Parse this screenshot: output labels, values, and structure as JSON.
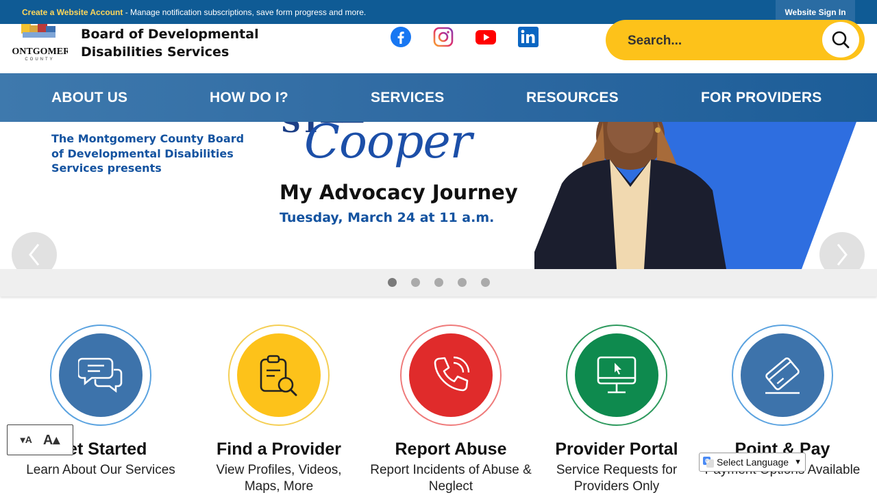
{
  "topbar": {
    "promo_link": "Create a Website Account",
    "promo_text": " - Manage notification subscriptions, save form progress and more.",
    "signin": "Website Sign In"
  },
  "header": {
    "logo_text_line1": "Board of Developmental",
    "logo_text_line2": "Disabilities Services",
    "logo_lettering": "MONTGOMERY COUNTY",
    "social": [
      "facebook-icon",
      "instagram-icon",
      "youtube-icon",
      "linkedin-icon"
    ]
  },
  "search": {
    "placeholder": "Search..."
  },
  "nav": {
    "items": [
      "ABOUT US",
      "HOW DO I?",
      "SERVICES",
      "RESOURCES",
      "FOR PROVIDERS"
    ]
  },
  "hero": {
    "intro": "The Montgomery County Board of Developmental Disabilities Services presents",
    "name_partial": "Cooper",
    "event": "My Advocacy Journey",
    "date": "Tuesday, March 24 at 11 a.m.",
    "slides": 5,
    "active_slide": 1
  },
  "tiles": [
    {
      "title": "Get Started",
      "subtitle": "Learn About Our Services",
      "icon": "chat-bubbles-icon",
      "color": "#3d73ab",
      "ring": "#5ba3e0"
    },
    {
      "title": "Find a Provider",
      "subtitle": "View Profiles, Videos, Maps, More",
      "icon": "clipboard-search-icon",
      "color": "#fdc21a",
      "ring": "#f5cf55"
    },
    {
      "title": "Report Abuse",
      "subtitle": "Report Incidents of Abuse & Neglect",
      "icon": "phone-icon",
      "color": "#e02b2b",
      "ring": "#ef7b7b"
    },
    {
      "title": "Provider Portal",
      "subtitle": "Service Requests for Providers Only",
      "icon": "monitor-cursor-icon",
      "color": "#0e8a4e",
      "ring": "#2e9a5e"
    },
    {
      "title": "Point & Pay",
      "subtitle": "Payment Options Available",
      "icon": "credit-card-icon",
      "color": "#3d73ab",
      "ring": "#5ba3e0"
    }
  ],
  "fontsize": {
    "small": "A",
    "large": "A"
  },
  "translate": {
    "label": "Select Language"
  },
  "colors": {
    "topbar": "#0f5b95",
    "nav": "#2f6aa2",
    "search": "#fdc21a",
    "hero_blue": "#1453a0"
  }
}
